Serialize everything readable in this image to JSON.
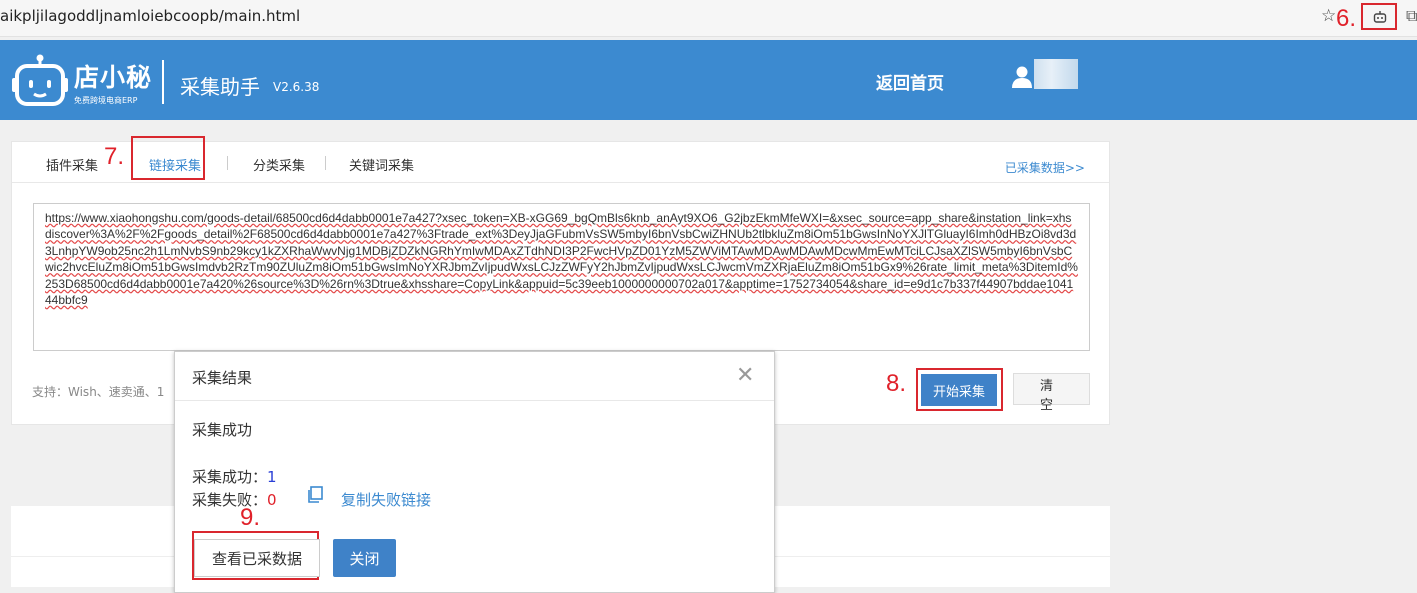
{
  "browser": {
    "url": "aikpljilagoddljnamloiebcoopb/main.html",
    "star": "☆",
    "ext_icon": "robot-icon",
    "puzzle": "⧉"
  },
  "annotations": {
    "a6": "6.",
    "a7": "7.",
    "a8": "8.",
    "a9": "9."
  },
  "header": {
    "brand": "店小秘",
    "brand_sub": "免费跨境电商ERP",
    "app_name": "采集助手",
    "version": "V2.6.38",
    "home_link": "返回首页",
    "user_icon": "user-icon",
    "bg_color": "#3c8ad0"
  },
  "tabs": [
    {
      "label": "插件采集"
    },
    {
      "label": "链接采集",
      "active": true
    },
    {
      "label": "分类采集"
    },
    {
      "label": "关键词采集"
    }
  ],
  "collected_link": "已采集数据>>",
  "url_input": "https://www.xiaohongshu.com/goods-detail/68500cd6d4dabb0001e7a427?xsec_token=XB-xGG69_bgQmBls6knb_anAyt9XO6_G2jbzEkmMfeWXI=&xsec_source=app_share&instation_link=xhsdiscover%3A%2F%2Fgoods_detail%2F68500cd6d4dabb0001e7a427%3Ftrade_ext%3DeyJjaGFubmVsSW5mbyI6bnVsbCwiZHNUb2tlbkluZm8iOm51bGwsInNoYXJlTGluayI6Imh0dHBzOi8vd3d3LnhpYW9ob25nc2h1LmNvbS9nb29kcy1kZXRhaWwvNjg1MDBjZDZkNGRhYmIwMDAxZTdhNDI3P2FwcHVpZD01YzM5ZWViMTAwMDAwMDAwMDcwMmEwMTciLCJsaXZlSW5mbyI6bnVsbCwic2hvcEluZm8iOm51bGwsImdvb2RzTm90ZUluZm8iOm51bGwsImNoYXRJbmZvIjpudWxsLCJzZWFyY2hJbmZvIjpudWxsLCJwcmVmZXRjaEluZm8iOm51bGx9%26rate_limit_meta%3DitemId%253D68500cd6d4dabb0001e7a420%26source%3D%26rn%3Dtrue&xhsshare=CopyLink&appuid=5c39eeb1000000000702a017&apptime=1752734054&share_id=e9d1c7b337f44907bddae104144bbfc9",
  "support_text": "支持：Wish、速卖通、1",
  "buttons": {
    "start": "开始采集",
    "clear": "清空"
  },
  "modal": {
    "title": "采集结果",
    "close_glyph": "✕",
    "message": "采集成功",
    "success_label": "采集成功：",
    "success_count": "1",
    "fail_label": "采集失败：",
    "fail_count": "0",
    "copy_fail_link": "复制失败链接",
    "view_button": "查看已采数据",
    "close_button": "关闭"
  }
}
